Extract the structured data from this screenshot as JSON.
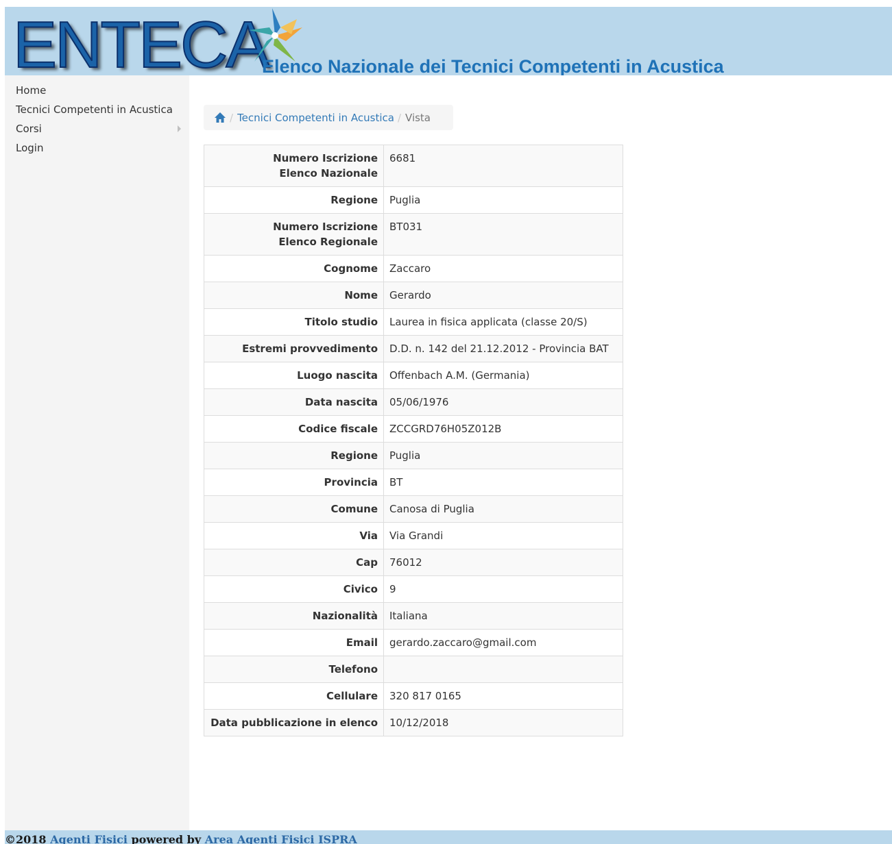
{
  "header": {
    "logo_text": "ENTECA",
    "subtitle": "Elenco Nazionale dei Tecnici Competenti in Acustica"
  },
  "sidebar": {
    "items": [
      {
        "label": "Home"
      },
      {
        "label": "Tecnici Competenti in Acustica"
      },
      {
        "label": "Corsi",
        "has_submenu": true
      },
      {
        "label": "Login"
      }
    ]
  },
  "breadcrumb": {
    "home_icon": "home-icon",
    "separator": "/",
    "link": "Tecnici Competenti in Acustica",
    "active": "Vista"
  },
  "details": {
    "rows": [
      {
        "label_line1": "Numero Iscrizione",
        "label_line2": "Elenco Nazionale",
        "value": "6681"
      },
      {
        "label": "Regione",
        "value": "Puglia"
      },
      {
        "label_line1": "Numero Iscrizione",
        "label_line2": "Elenco Regionale",
        "value": "BT031"
      },
      {
        "label": "Cognome",
        "value": "Zaccaro"
      },
      {
        "label": "Nome",
        "value": "Gerardo"
      },
      {
        "label": "Titolo studio",
        "value": "Laurea in fisica applicata (classe 20/S)"
      },
      {
        "label": "Estremi provvedimento",
        "value": "D.D. n. 142 del 21.12.2012 - Provincia BAT"
      },
      {
        "label": "Luogo nascita",
        "value": "Offenbach A.M. (Germania)"
      },
      {
        "label": "Data nascita",
        "value": "05/06/1976"
      },
      {
        "label": "Codice fiscale",
        "value": "ZCCGRD76H05Z012B"
      },
      {
        "label": "Regione",
        "value": "Puglia"
      },
      {
        "label": "Provincia",
        "value": "BT"
      },
      {
        "label": "Comune",
        "value": "Canosa di Puglia"
      },
      {
        "label": "Via",
        "value": "Via Grandi"
      },
      {
        "label": "Cap",
        "value": "76012"
      },
      {
        "label": "Civico",
        "value": "9"
      },
      {
        "label": "Nazionalità",
        "value": "Italiana"
      },
      {
        "label": "Email",
        "value": "gerardo.zaccaro@gmail.com"
      },
      {
        "label": "Telefono",
        "value": ""
      },
      {
        "label": "Cellulare",
        "value": "320 817 0165"
      },
      {
        "label": "Data pubblicazione in elenco",
        "value": "10/12/2018"
      }
    ]
  },
  "footer": {
    "copyright": "©2018",
    "link1": "Agenti Fisici",
    "powered_by": "powered by",
    "link2": "Area Agenti Fisici ISPRA"
  },
  "colors": {
    "header_bg": "#b9d7eb",
    "subtitle": "#1f72b7",
    "link": "#337ab7",
    "sidebar_bg": "#f4f4f4"
  }
}
